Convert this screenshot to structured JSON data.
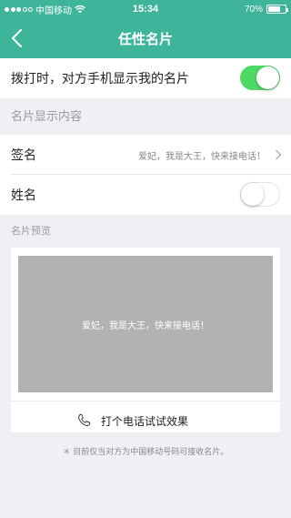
{
  "status_bar": {
    "carrier": "中国移动",
    "time": "15:34",
    "battery": "70%",
    "battery_level": 0.7,
    "signal_filled": 3,
    "signal_total": 5
  },
  "nav": {
    "title": "任性名片",
    "back_icon": "chevron-left-icon"
  },
  "dial_toggle": {
    "label": "拨打时，对方手机显示我的名片",
    "on": true
  },
  "content_section": {
    "title": "名片显示内容"
  },
  "signature_row": {
    "label": "签名",
    "value": "爱妃，我是大王，快来接电话！"
  },
  "name_row": {
    "label": "姓名",
    "on": false
  },
  "preview": {
    "title": "名片预览",
    "image_text": "爱妃，我是大王，快来接电话！",
    "call_test_label": "打个电话试试效果"
  },
  "footnote": "＊ 目前仅当对方为中国移动号码可接收名片。",
  "colors": {
    "accent": "#3eb59a",
    "toggle_on": "#4cd964",
    "preview_bg": "#b2b2b2"
  }
}
